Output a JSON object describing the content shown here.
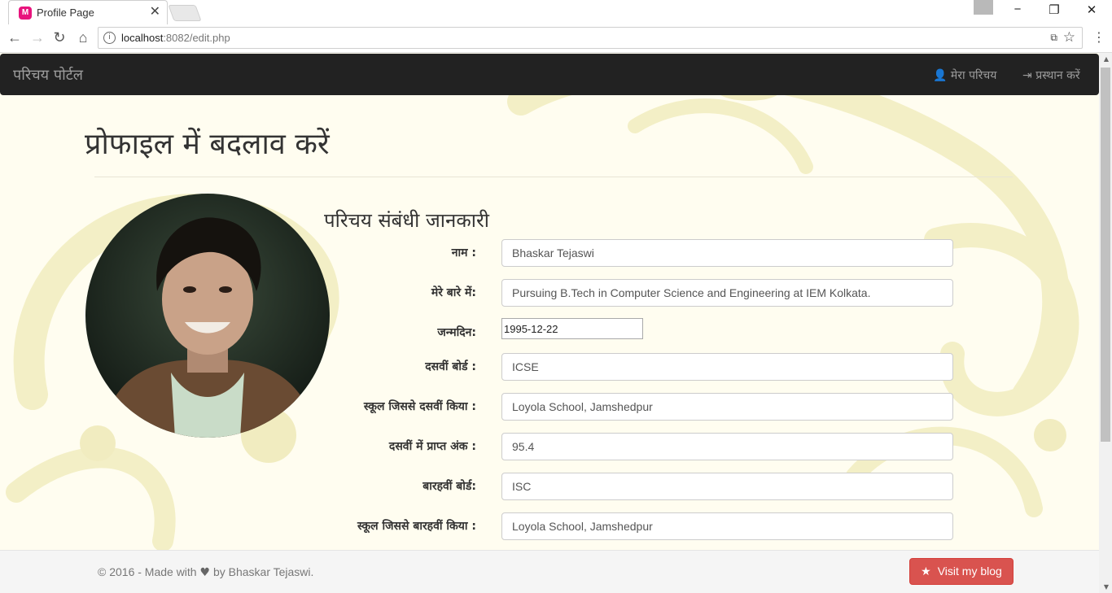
{
  "browser": {
    "tab_title": "Profile Page",
    "favicon_text": "M",
    "url_host": "localhost",
    "url_path": ":8082/edit.php"
  },
  "navbar": {
    "brand": "परिचय पोर्टल",
    "my_profile": "मेरा परिचय",
    "logout": "प्रस्थान करें"
  },
  "page": {
    "title": "प्रोफाइल में बदलाव करें",
    "section_title": "परिचय संबंधी जानकारी"
  },
  "form": {
    "name_label": "नाम :",
    "name_value": "Bhaskar Tejaswi",
    "about_label": "मेरे बारे में:",
    "about_value": "Pursuing B.Tech in Computer Science and Engineering at IEM Kolkata.",
    "dob_label": "जन्मदिन:",
    "dob_value": "1995-12-22",
    "board10_label": "दसवीं बोर्ड :",
    "board10_value": "ICSE",
    "school10_label": "स्कूल जिससे दसवीं किया :",
    "school10_value": "Loyola School, Jamshedpur",
    "marks10_label": "दसवीं में प्राप्त अंक :",
    "marks10_value": "95.4",
    "board12_label": "बारहवीं बोर्ड:",
    "board12_value": "ISC",
    "school12_label": "स्कूल जिससे बारहवीं किया :",
    "school12_value": "Loyola School, Jamshedpur"
  },
  "footer": {
    "text_before": "© 2016 - Made with ",
    "text_after": " by Bhaskar Tejaswi.",
    "blog_button": "Visit my blog"
  },
  "icons": {
    "heart": "heart-icon",
    "star": "star-icon",
    "user": "user-icon",
    "logout": "logout-icon"
  },
  "colors": {
    "navbar_bg": "#222222",
    "button_danger": "#d9534f",
    "page_bg": "#fffdf0",
    "swirl": "#f3efc6"
  }
}
